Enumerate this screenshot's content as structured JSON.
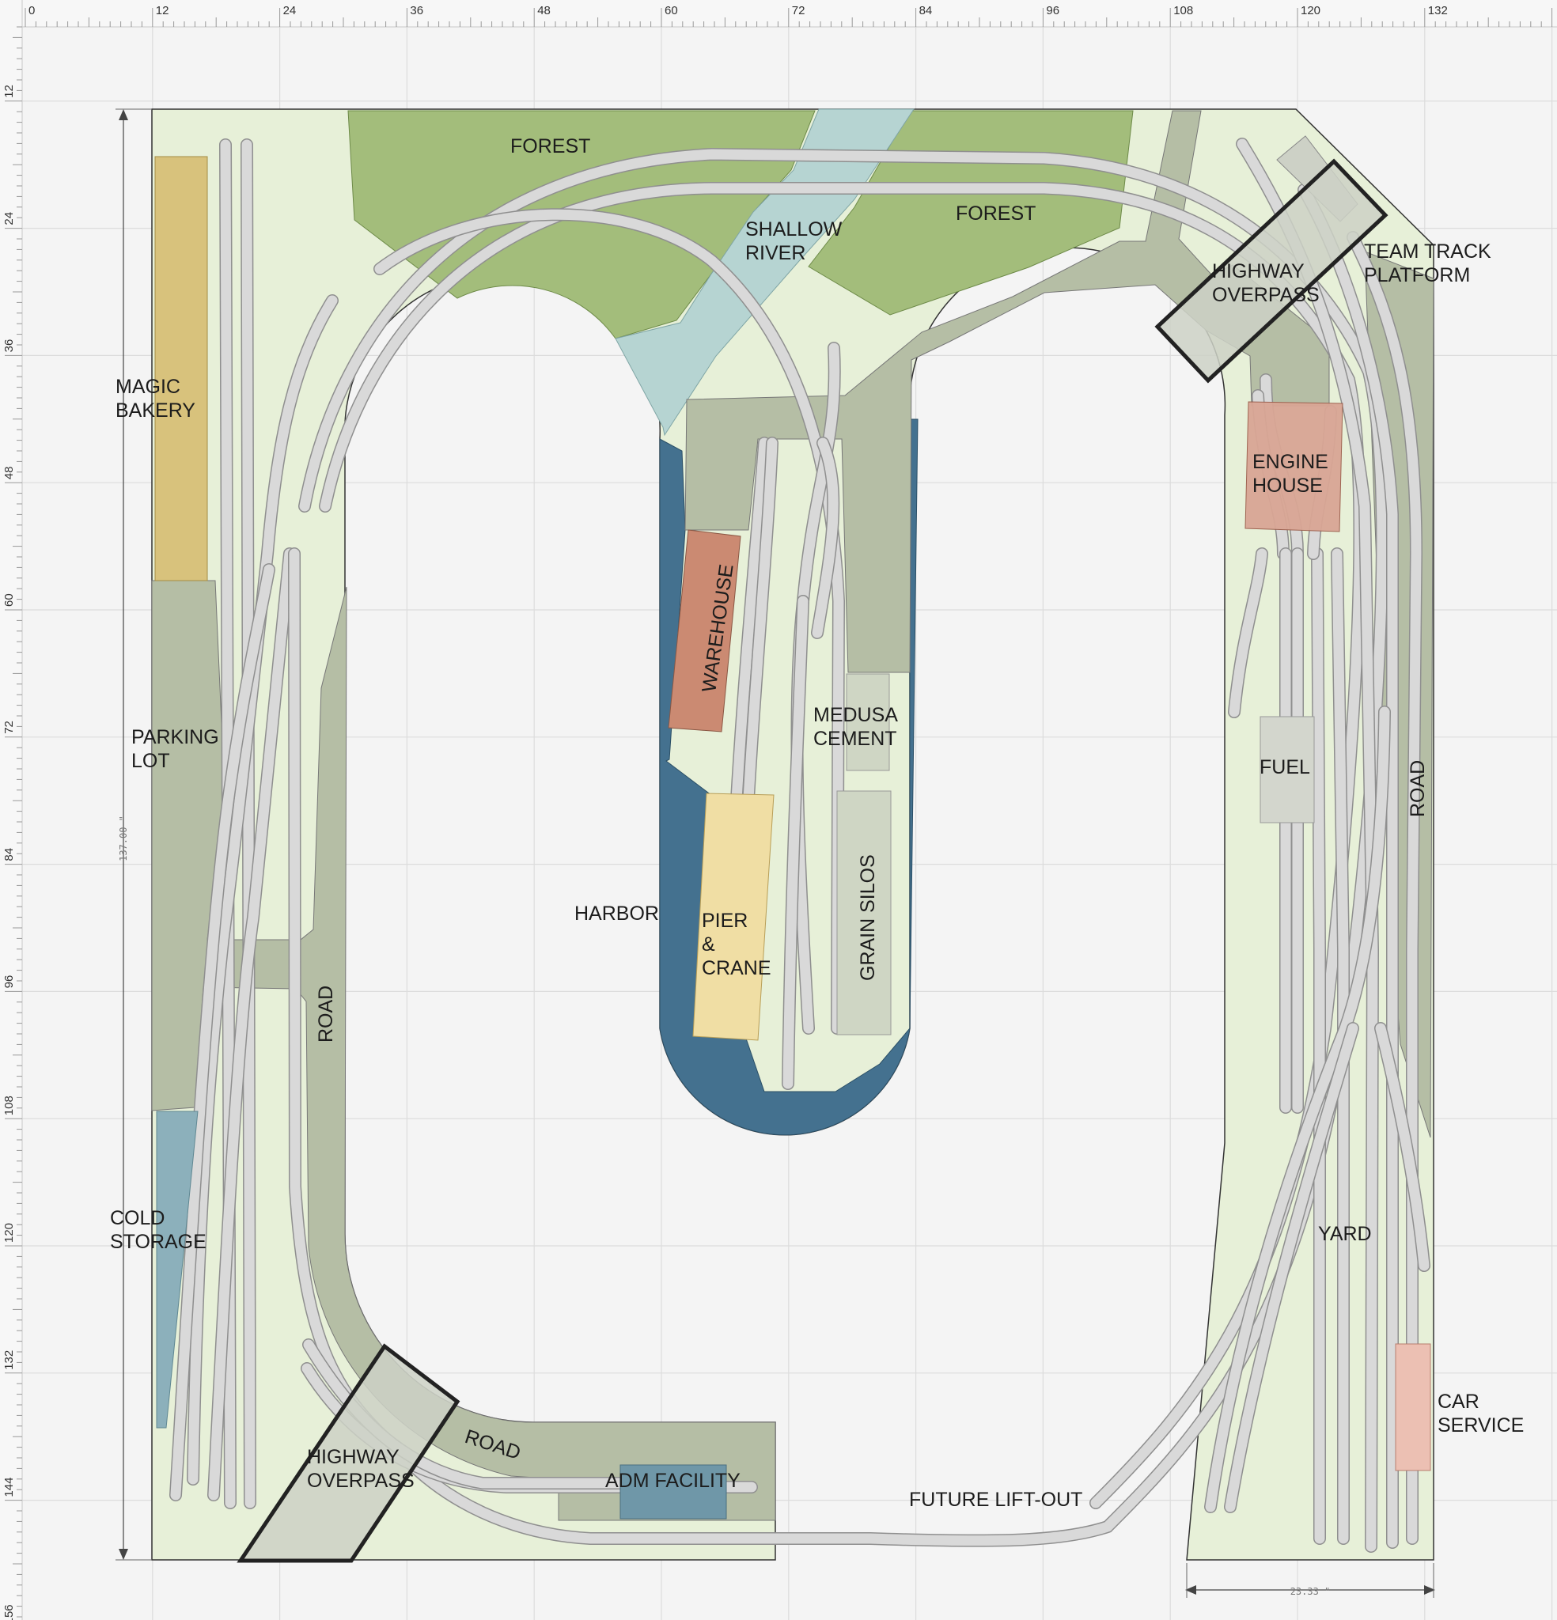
{
  "ruler": {
    "top_ticks": [
      "0",
      "12",
      "24",
      "36",
      "48",
      "60",
      "72",
      "84",
      "96",
      "108",
      "120",
      "132"
    ],
    "left_ticks": [
      "12",
      "24",
      "36",
      "48",
      "60",
      "72",
      "84",
      "96",
      "108",
      "120",
      "132",
      "144",
      "156"
    ]
  },
  "dimensions": {
    "height": "137.00 \"",
    "width": "23.33 \""
  },
  "labels": {
    "forest_left": "FOREST",
    "forest_right": "FOREST",
    "river_1": "SHALLOW",
    "river_2": "RIVER",
    "magic_1": "MAGIC",
    "magic_2": "BAKERY",
    "parking_1": "PARKING",
    "parking_2": "LOT",
    "cold_1": "COLD",
    "cold_2": "STORAGE",
    "road_left": "ROAD",
    "road_bottom": "ROAD",
    "road_right": "ROAD",
    "overpass_bottom_1": "HIGHWAY",
    "overpass_bottom_2": "OVERPASS",
    "overpass_top_1": "HIGHWAY",
    "overpass_top_2": "OVERPASS",
    "adm": "ADM FACILITY",
    "lift_out": "FUTURE LIFT-OUT",
    "warehouse": "WAREHOUSE",
    "harbor": "HARBOR",
    "pier_1": "PIER",
    "pier_2": "&",
    "pier_3": "CRANE",
    "medusa_1": "MEDUSA",
    "medusa_2": "CEMENT",
    "grain": "GRAIN SILOS",
    "engine_1": "ENGINE",
    "engine_2": "HOUSE",
    "fuel": "FUEL",
    "team_1": "TEAM TRACK",
    "team_2": "PLATFORM",
    "yard": "YARD",
    "car_1": "CAR",
    "car_2": "SERVICE"
  },
  "colors": {
    "background": "#f4f4f4",
    "benchwork": "#e7f0d8",
    "forest": "#a3bd7b",
    "river": "#b6d4d2",
    "harbor_water": "#44718f",
    "road": "#b5bea5",
    "track": "#d9d9d9",
    "bakery": "#d8c27c",
    "cold_storage": "#8cb0bb",
    "warehouse": "#cb8a72",
    "pier": "#f0dea4",
    "silos": "#cfd6c4",
    "engine_house": "#d9a695",
    "car_service": "#ecc0b3",
    "adm": "#6f97a8"
  }
}
